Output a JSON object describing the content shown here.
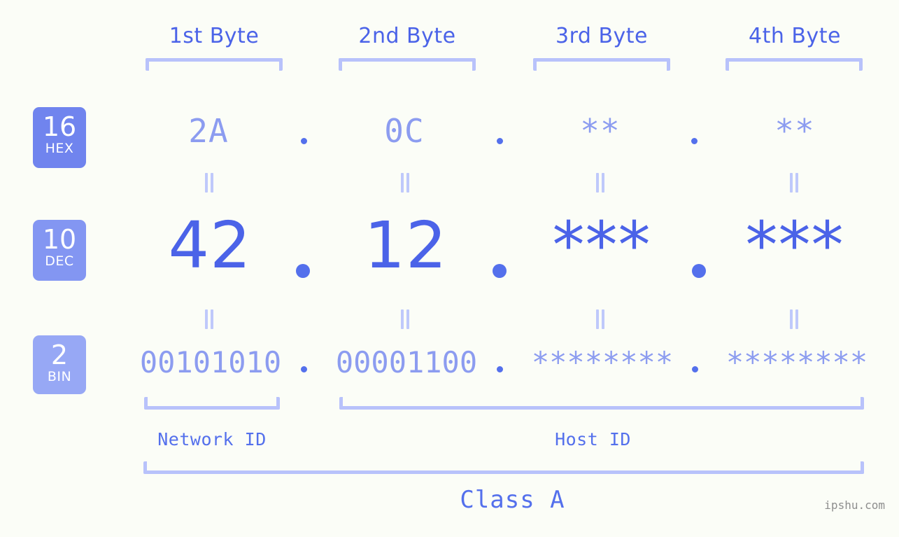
{
  "meta": {
    "background": "#fbfdf7",
    "accent_dark": "#4b63e8",
    "accent_mid": "#7b8cf0",
    "accent_light": "#8c9cf0",
    "bracket_color": "#b8c2fb"
  },
  "byte_headers": [
    {
      "label": "1st Byte"
    },
    {
      "label": "2nd Byte"
    },
    {
      "label": "3rd Byte"
    },
    {
      "label": "4th Byte"
    }
  ],
  "bases": [
    {
      "number": "16",
      "abbr": "HEX",
      "color": "#7084ee"
    },
    {
      "number": "10",
      "abbr": "DEC",
      "color": "#8396f2"
    },
    {
      "number": "2",
      "abbr": "BIN",
      "color": "#97a8f5"
    }
  ],
  "rows": {
    "hex": {
      "values": [
        "2A",
        "0C",
        "**",
        "**"
      ]
    },
    "dec": {
      "values": [
        "42",
        "12",
        "***",
        "***"
      ]
    },
    "bin": {
      "values": [
        "00101010",
        "00001100",
        "********",
        "********"
      ]
    }
  },
  "separator": ".",
  "equals_mark": "=",
  "segments": [
    {
      "label": "Network ID"
    },
    {
      "label": "Host ID"
    }
  ],
  "class": {
    "label": "Class A"
  },
  "watermark": {
    "text": "ipshu.com"
  }
}
